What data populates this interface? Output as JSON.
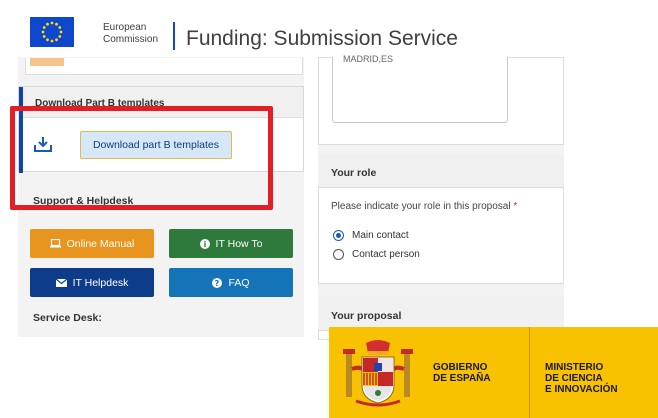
{
  "header": {
    "org_line1": "European",
    "org_line2": "Commission",
    "service_title": "Funding: Submission Service",
    "logo_icon": "eu-flag-icon"
  },
  "left_panel": {
    "download_section": {
      "title": "Download Part B templates",
      "icon": "download-icon",
      "button_label": "Download part B templates"
    },
    "support_section": {
      "title": "Support & Helpdesk",
      "buttons": [
        {
          "label": "Online Manual",
          "icon": "laptop-icon",
          "color": "#e8951f"
        },
        {
          "label": "IT How To",
          "icon": "info-icon",
          "color": "#2e7a3c"
        },
        {
          "label": "IT Helpdesk",
          "icon": "envelope-icon",
          "color": "#0d3d8a"
        },
        {
          "label": "FAQ",
          "icon": "question-icon",
          "color": "#1574b8"
        }
      ],
      "service_desk_label": "Service Desk:"
    }
  },
  "right_panel": {
    "address_text": "MADRID,ES",
    "role_section": {
      "title": "Your role",
      "question": "Please indicate your role in this proposal",
      "required_mark": "*",
      "options": [
        {
          "label": "Main contact",
          "selected": true
        },
        {
          "label": "Contact person",
          "selected": false
        }
      ]
    },
    "proposal_section": {
      "title": "Your proposal"
    }
  },
  "overlay": {
    "highlight_color": "#e31e24"
  },
  "gobierno_banner": {
    "left_line1": "GOBIERNO",
    "left_line2": "DE ESPAÑA",
    "right_line1": "MINISTERIO",
    "right_line2": "DE CIENCIA",
    "right_line3": "E INNOVACIÓN",
    "logo_icon": "spain-coat-of-arms-icon",
    "background": "#f8c200"
  }
}
